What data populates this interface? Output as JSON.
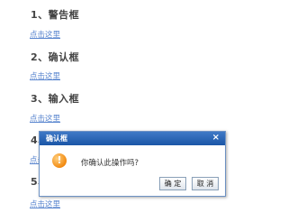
{
  "sections": [
    {
      "heading": "1、警告框",
      "link": "点击这里"
    },
    {
      "heading": "2、确认框",
      "link": "点击这里"
    },
    {
      "heading": "3、输入框",
      "link": "点击这里"
    },
    {
      "heading": "4、",
      "link": "点击这里"
    },
    {
      "heading": "5、",
      "link": "点击这里"
    }
  ],
  "dialog": {
    "title": "确认框",
    "close": "×",
    "icon": "exclamation-icon",
    "message": "你确认此操作吗?",
    "ok_label": "确 定",
    "cancel_label": "取 消"
  }
}
